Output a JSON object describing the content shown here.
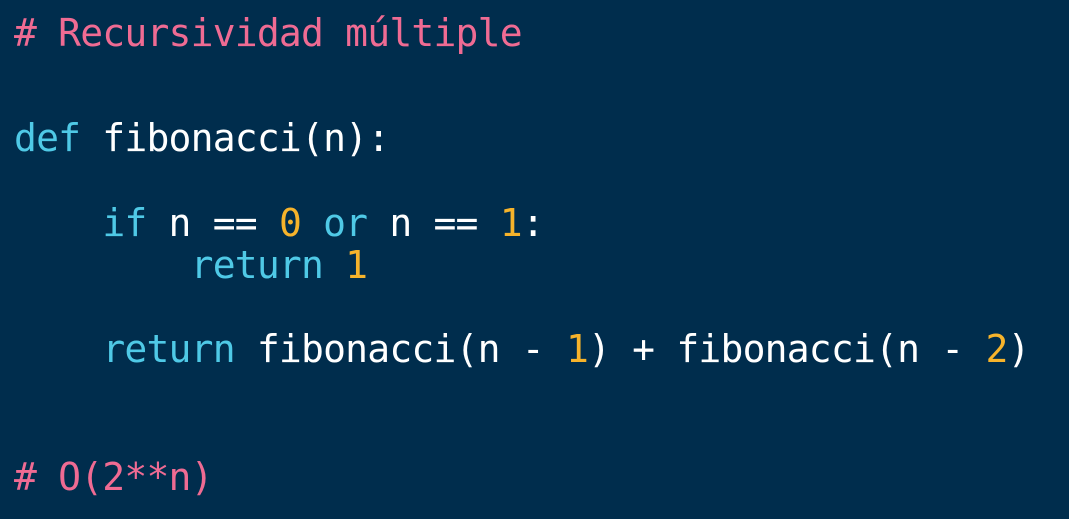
{
  "code": {
    "lines": [
      {
        "tokens": [
          {
            "text": "# Recursividad múltiple",
            "type": "comment"
          }
        ]
      },
      {
        "tokens": [
          {
            "text": "def",
            "type": "keyword"
          },
          {
            "text": " fibonacci(n):",
            "type": "plain"
          }
        ]
      },
      {
        "tokens": [
          {
            "text": "    ",
            "type": "plain"
          },
          {
            "text": "if",
            "type": "keyword"
          },
          {
            "text": " n == ",
            "type": "plain"
          },
          {
            "text": "0",
            "type": "number"
          },
          {
            "text": " ",
            "type": "plain"
          },
          {
            "text": "or",
            "type": "keyword"
          },
          {
            "text": " n == ",
            "type": "plain"
          },
          {
            "text": "1",
            "type": "number"
          },
          {
            "text": ":",
            "type": "plain"
          }
        ]
      },
      {
        "tokens": [
          {
            "text": "        ",
            "type": "plain"
          },
          {
            "text": "return",
            "type": "keyword"
          },
          {
            "text": " ",
            "type": "plain"
          },
          {
            "text": "1",
            "type": "number"
          }
        ]
      },
      {
        "tokens": [
          {
            "text": "    ",
            "type": "plain"
          },
          {
            "text": "return",
            "type": "keyword"
          },
          {
            "text": " fibonacci(n - ",
            "type": "plain"
          },
          {
            "text": "1",
            "type": "number"
          },
          {
            "text": ") + fibonacci(n - ",
            "type": "plain"
          },
          {
            "text": "2",
            "type": "number"
          },
          {
            "text": ")",
            "type": "plain"
          }
        ]
      },
      {
        "tokens": [
          {
            "text": "# O(2**n)",
            "type": "comment"
          }
        ]
      }
    ]
  },
  "colors": {
    "background": "#002d4d",
    "comment": "#ef6b93",
    "keyword": "#4fc9e6",
    "number": "#f6b32b",
    "plain": "#ffffff"
  }
}
